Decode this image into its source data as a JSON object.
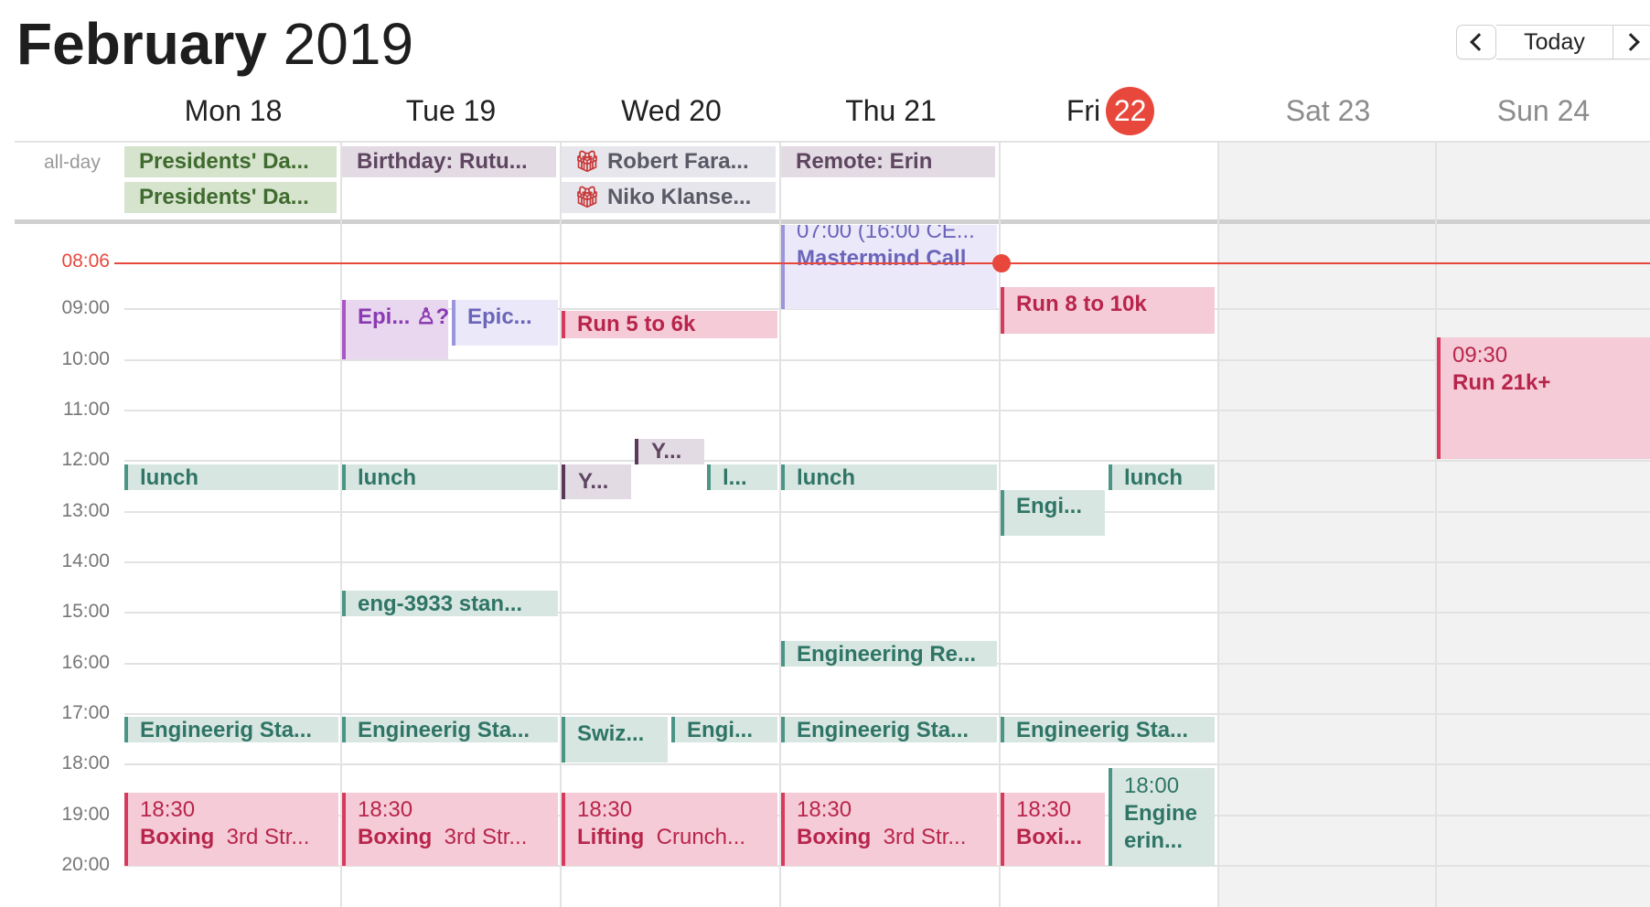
{
  "header": {
    "month": "February",
    "year": "2019"
  },
  "nav": {
    "prev_label": "‹",
    "today_label": "Today",
    "next_label": "›"
  },
  "days": [
    {
      "label": "Mon 18"
    },
    {
      "label": "Tue 19"
    },
    {
      "label": "Wed 20"
    },
    {
      "label": "Thu 21"
    },
    {
      "label": "Fri",
      "num": "22",
      "is_today": true
    },
    {
      "label": "Sat 23",
      "weekend": true
    },
    {
      "label": "Sun 24",
      "weekend": true
    }
  ],
  "allday": {
    "label": "all-day",
    "events": [
      {
        "title": "Presidents' Da...",
        "color": "#d6e3cd"
      },
      {
        "title": "Presidents' Da...",
        "color": "#d6e3cd"
      },
      {
        "title": "Birthday: Rutu...",
        "color": "#e3dbe3"
      },
      {
        "title": "Robert Fara...",
        "icon": "gift-icon"
      },
      {
        "title": "Niko Klanse...",
        "icon": "gift-icon"
      },
      {
        "title": "Remote: Erin",
        "color": "#e3dbe3"
      }
    ]
  },
  "now": {
    "time": "08:06"
  },
  "hours": [
    "09:00",
    "10:00",
    "11:00",
    "12:00",
    "13:00",
    "14:00",
    "15:00",
    "16:00",
    "17:00",
    "18:00",
    "19:00",
    "20:00"
  ],
  "events": {
    "thu_mastermind": {
      "time": "07:00 (16:00 CE...",
      "title": "Mastermind Call"
    },
    "tue_epi1": {
      "title": "Epi... ♙?"
    },
    "tue_epic2": {
      "title": "Epic..."
    },
    "wed_run": {
      "title": "Run 5 to 6k"
    },
    "fri_run": {
      "title": "Run 8 to 10k"
    },
    "sun_run": {
      "time": "09:30",
      "title": "Run 21k+"
    },
    "wed_y1": {
      "title": "Y..."
    },
    "wed_y2": {
      "title": "Y..."
    },
    "wed_l": {
      "title": "l..."
    },
    "mon_lunch": {
      "title": "lunch"
    },
    "tue_lunch": {
      "title": "lunch"
    },
    "thu_lunch": {
      "title": "lunch"
    },
    "fri_lunch": {
      "title": "lunch"
    },
    "fri_engi": {
      "title": "Engi..."
    },
    "tue_eng3933": {
      "title": "eng-3933 stan..."
    },
    "thu_engre": {
      "title": "Engineering Re..."
    },
    "mon_es": {
      "title": "Engineerig Sta..."
    },
    "tue_es": {
      "title": "Engineerig Sta..."
    },
    "wed_swiz": {
      "title": "Swiz..."
    },
    "wed_engi": {
      "title": "Engi..."
    },
    "thu_es": {
      "title": "Engineerig Sta..."
    },
    "fri_es": {
      "title": "Engineerig Sta..."
    },
    "fri_engine": {
      "time": "18:00",
      "title1": "Engine",
      "title2": "erin..."
    },
    "mon_box": {
      "time": "18:30",
      "title": "Boxing",
      "loc": "3rd Str..."
    },
    "tue_box": {
      "time": "18:30",
      "title": "Boxing",
      "loc": "3rd Str..."
    },
    "wed_lift": {
      "time": "18:30",
      "title": "Lifting",
      "loc": "Crunch..."
    },
    "thu_box": {
      "time": "18:30",
      "title": "Boxing",
      "loc": "3rd Str..."
    },
    "fri_box": {
      "time": "18:30",
      "title": "Boxi..."
    }
  },
  "colors": {
    "today": "#e8473b",
    "green_event": "#d8e6e2",
    "pink_event": "#f5cbd7"
  }
}
